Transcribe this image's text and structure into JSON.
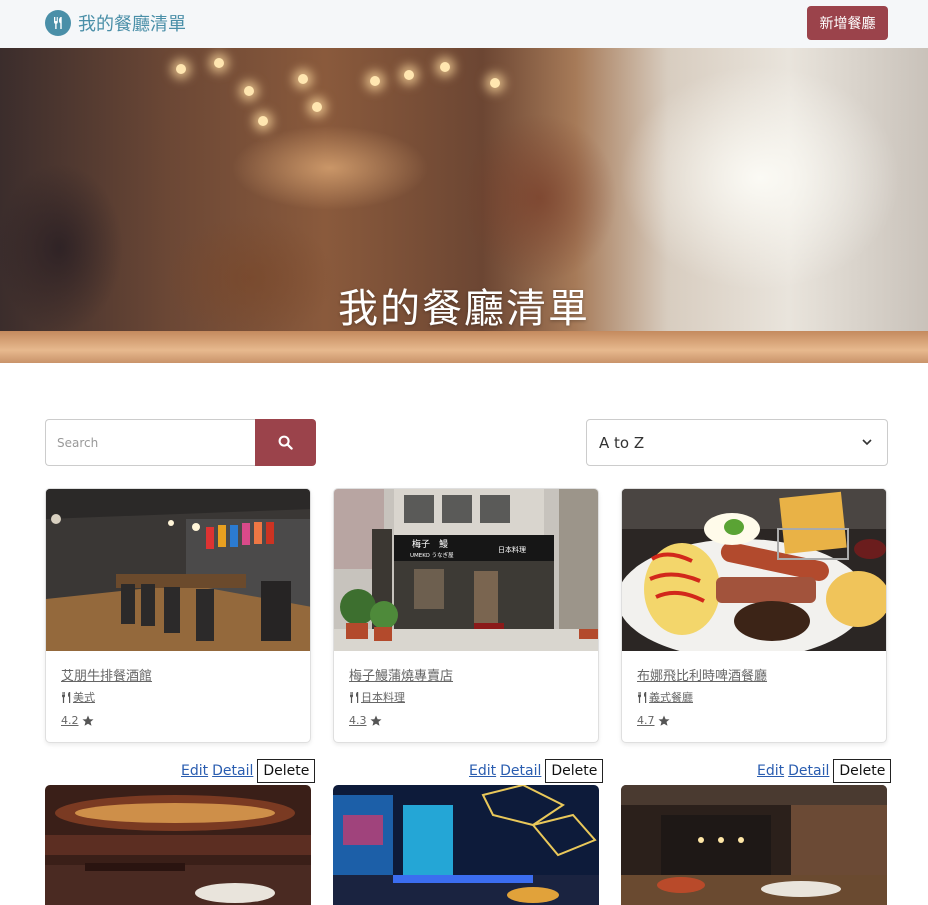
{
  "navbar": {
    "brand": "我的餐廳清單",
    "add_button": "新增餐廳"
  },
  "banner": {
    "title": "我的餐廳清單"
  },
  "search": {
    "placeholder": "Search"
  },
  "sort": {
    "selected": "A to Z"
  },
  "cards": [
    {
      "name": "艾朋牛排餐酒館",
      "category": "美式",
      "rating": "4.2"
    },
    {
      "name": "梅子鰻蒲燒專賣店",
      "category": "日本料理",
      "rating": "4.3"
    },
    {
      "name": "布娜飛比利時啤酒餐廳",
      "category": "義式餐廳",
      "rating": "4.7"
    }
  ],
  "actions": {
    "edit": "Edit",
    "detail": "Detail",
    "delete": "Delete"
  },
  "sign": {
    "line1": "梅子　鰻",
    "line2": "UMEKO うなぎ屋",
    "line3": "日本料理"
  },
  "colors": {
    "accent": "#9b434b",
    "brand": "#4a8fa8"
  }
}
